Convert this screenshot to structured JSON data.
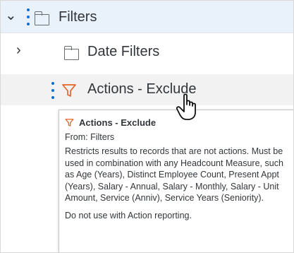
{
  "tree": {
    "root": {
      "label": "Filters"
    },
    "date_filters": {
      "label": "Date Filters"
    },
    "actions_exclude": {
      "label": "Actions - Exclude"
    }
  },
  "tooltip": {
    "title": "Actions - Exclude",
    "from": "From: Filters",
    "description": "Restricts results to records that are not actions. Must be used in combination with any Headcount Measure, such as Age (Years), Distinct Employee Count, Present Appt (Years), Salary - Annual, Salary - Monthly, Salary - Unit Amount, Service (Anniv), Service Years (Seniority).",
    "note": "Do not use with Action reporting."
  },
  "icons": {
    "expand": "chevron-down-icon",
    "collapse": "chevron-right-icon",
    "folder": "folder-icon",
    "filter": "funnel-icon",
    "drag": "drag-handle-icon",
    "pointer": "hand-pointer-icon"
  },
  "colors": {
    "selected_row": "#e9f1fa",
    "hover_row": "#f2f2f2",
    "drag_handle": "#0a6ed1",
    "filter_icon": "#e8632c"
  }
}
